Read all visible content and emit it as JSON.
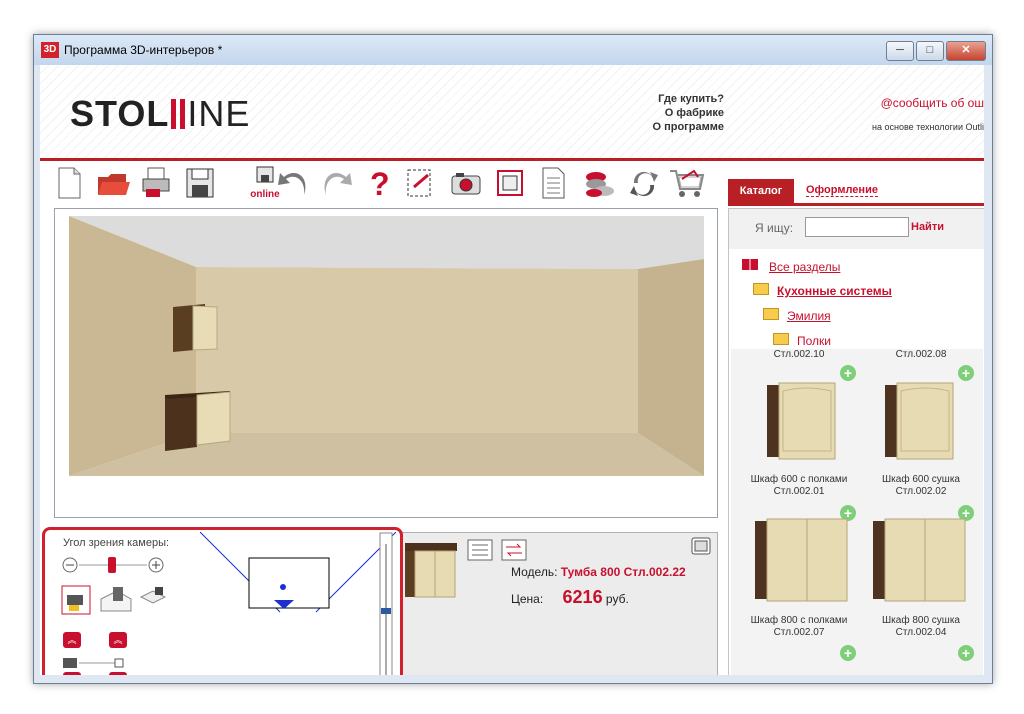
{
  "window": {
    "icon_text": "3D",
    "title": "Программа 3D-интерьеров *",
    "controls": {
      "minimize": "─",
      "maximize": "□",
      "close": "✕"
    }
  },
  "header": {
    "logo_left": "STOL",
    "logo_right": "INE",
    "links": [
      "Где купить?",
      "О фабрике",
      "О программе"
    ],
    "email_link": "@сообщить об ош",
    "tech_note": "на основе технологии Outli"
  },
  "toolbar": {
    "online_label": "online",
    "buttons": [
      "new-file-icon",
      "open-folder-icon",
      "print-icon",
      "save-icon",
      "online-save-icon",
      "undo-icon",
      "redo-icon",
      "help-icon",
      "select-area-icon",
      "camera-icon",
      "frame-icon",
      "document-icon",
      "coins-icon",
      "refresh-icon",
      "cart-icon"
    ]
  },
  "tabs": {
    "catalog": "Каталог",
    "design": "Оформление"
  },
  "search": {
    "label": "Я ищу:",
    "placeholder": "",
    "button": "Найти"
  },
  "tree": {
    "all": "Все разделы",
    "kitchen": "Кухонные системы",
    "emilia": "Эмилия",
    "shelves": "Полки"
  },
  "catalog_items": [
    {
      "top_code": "Стл.002.10",
      "name": "Шкаф 600 с полками",
      "code": "Стл.002.01"
    },
    {
      "top_code": "Стл.002.08",
      "name": "Шкаф 600 сушка",
      "code": "Стл.002.02"
    },
    {
      "top_code": "",
      "name": "Шкаф 800 с полками",
      "code": "Стл.002.07"
    },
    {
      "top_code": "",
      "name": "Шкаф 800 сушка",
      "code": "Стл.002.04"
    }
  ],
  "camera": {
    "label": "Угол зрения камеры:"
  },
  "details": {
    "model_label": "Модель:",
    "model_value": "Тумба 800 Стл.002.22",
    "price_label": "Цена:",
    "price_value": "6216",
    "price_unit": "руб."
  },
  "colors": {
    "accent": "#c8102e",
    "red_bar": "#b82025",
    "wall": "#d8c9a8",
    "floor": "#cfc0a1"
  }
}
